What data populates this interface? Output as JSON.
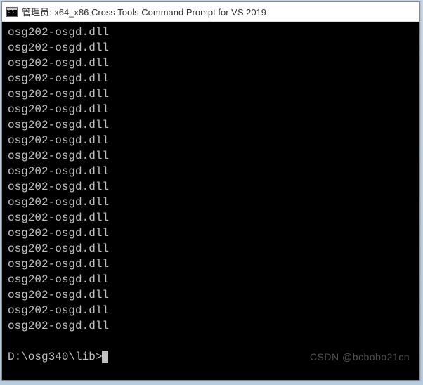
{
  "window": {
    "title": "管理员: x64_x86 Cross Tools Command Prompt for VS 2019"
  },
  "terminal": {
    "output_lines": [
      "osg202-osgd.dll",
      "osg202-osgd.dll",
      "osg202-osgd.dll",
      "osg202-osgd.dll",
      "osg202-osgd.dll",
      "osg202-osgd.dll",
      "osg202-osgd.dll",
      "osg202-osgd.dll",
      "osg202-osgd.dll",
      "osg202-osgd.dll",
      "osg202-osgd.dll",
      "osg202-osgd.dll",
      "osg202-osgd.dll",
      "osg202-osgd.dll",
      "osg202-osgd.dll",
      "osg202-osgd.dll",
      "osg202-osgd.dll",
      "osg202-osgd.dll",
      "osg202-osgd.dll",
      "osg202-osgd.dll"
    ],
    "prompt": "D:\\osg340\\lib>"
  },
  "watermark": "CSDN @bcbobo21cn"
}
